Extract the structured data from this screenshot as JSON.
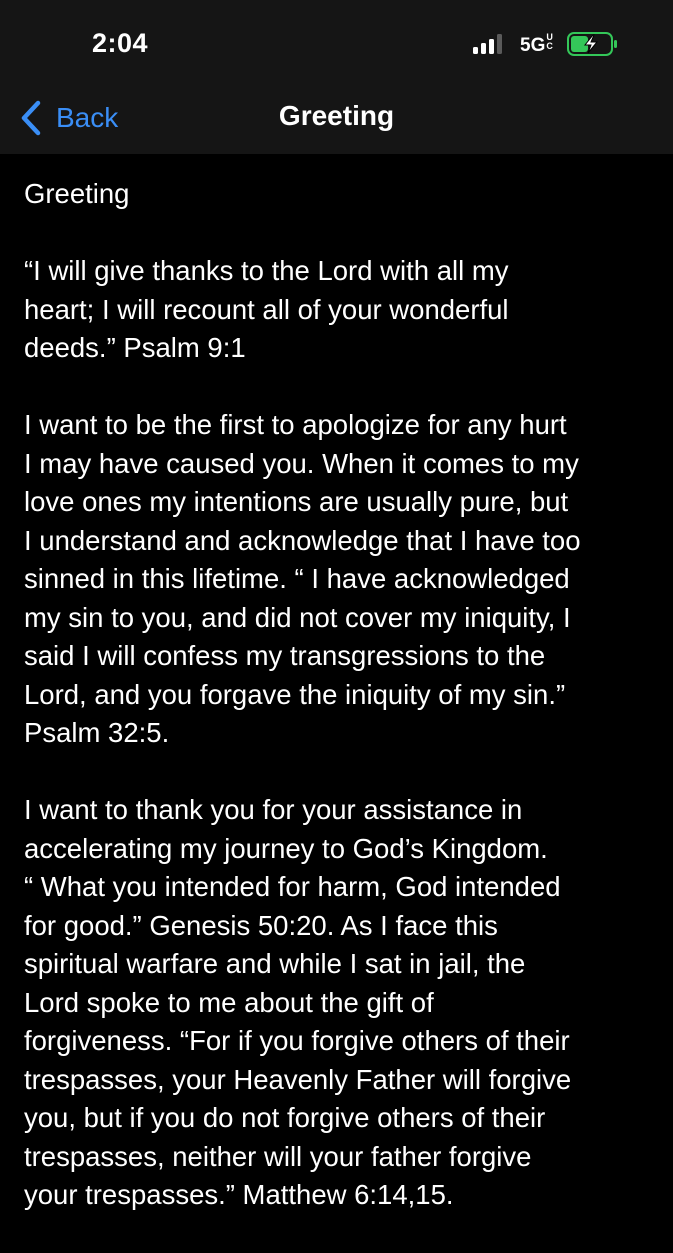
{
  "status_bar": {
    "time": "2:04",
    "network": "5G",
    "network_badge": "UC",
    "signal_bars": 3,
    "battery_state": "charging",
    "battery_color": "#34c759"
  },
  "navbar": {
    "back_label": "Back",
    "title": "Greeting",
    "accent_color": "#3a8ef6"
  },
  "note": {
    "heading": "Greeting",
    "paragraphs": [
      {
        "lines": [
          "“I will give thanks to the Lord with all my",
          "heart; I will recount all of your wonderful",
          "deeds.” Psalm 9:1"
        ]
      },
      {
        "lines": [
          "I want to be the first to apologize for any hurt",
          "I may have caused you. When it comes to my",
          "love ones my intentions are usually pure, but",
          "I understand and acknowledge that I have too",
          "sinned in this lifetime. “ I have acknowledged",
          "my sin to you, and did not cover my iniquity, I",
          "said I will confess my transgressions to the",
          "Lord, and you forgave the iniquity of my sin.”",
          "Psalm 32:5."
        ]
      },
      {
        "lines": [
          "I want to thank you for your assistance in",
          "accelerating my journey to God’s Kingdom.",
          "“ What you intended for harm, God intended",
          "for good.” Genesis 50:20. As I face this",
          "spiritual warfare and while I sat in jail, the",
          "Lord spoke to me about the gift of",
          "forgiveness. “For if you forgive others of their",
          "trespasses, your Heavenly Father will forgive",
          "you, but if you do not forgive others of their",
          "trespasses, neither will your father forgive",
          "your trespasses.” Matthew 6:14,15."
        ]
      }
    ]
  }
}
